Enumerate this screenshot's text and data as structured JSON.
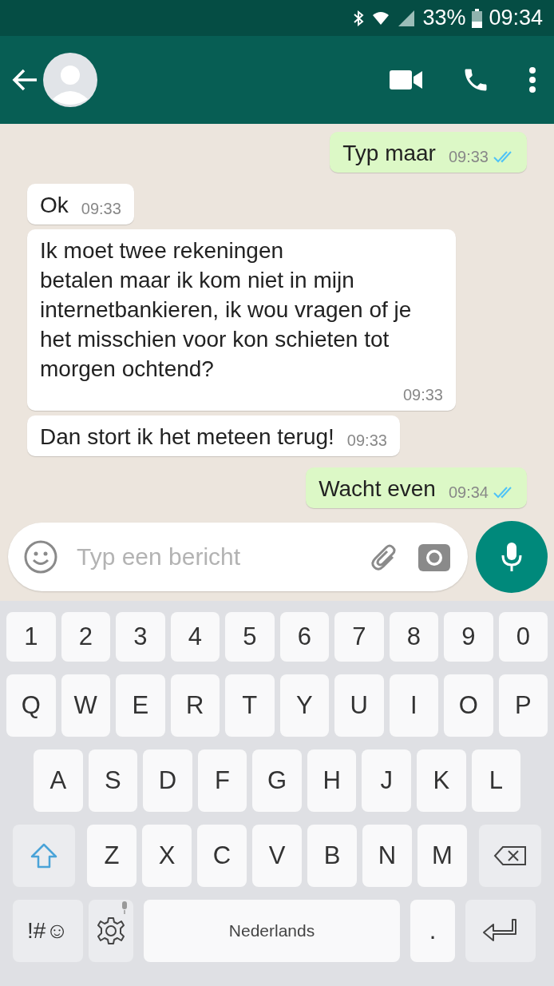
{
  "status_bar": {
    "battery": "33%",
    "time": "09:34"
  },
  "messages": [
    {
      "kind": "out",
      "text": "Typ maar",
      "time": "09:33",
      "read": true
    },
    {
      "kind": "in",
      "text": "Ok",
      "time": "09:33"
    },
    {
      "kind": "in",
      "text": "Ik moet twee rekeningen\nbetalen maar ik kom niet in mijn internetbankieren, ik wou vragen of je het misschien voor kon schieten tot morgen ochtend?",
      "time": "09:33"
    },
    {
      "kind": "in",
      "text": "Dan stort ik het meteen terug!",
      "time": "09:33"
    },
    {
      "kind": "out",
      "text": "Wacht even",
      "time": "09:34",
      "read": true
    }
  ],
  "composer": {
    "placeholder": "Typ een bericht"
  },
  "keyboard": {
    "rows": [
      {
        "keys": [
          {
            "kind": "char",
            "label": "1"
          },
          {
            "kind": "char",
            "label": "2"
          },
          {
            "kind": "char",
            "label": "3"
          },
          {
            "kind": "char",
            "label": "4"
          },
          {
            "kind": "char",
            "label": "5"
          },
          {
            "kind": "char",
            "label": "6"
          },
          {
            "kind": "char",
            "label": "7"
          },
          {
            "kind": "char",
            "label": "8"
          },
          {
            "kind": "char",
            "label": "9"
          },
          {
            "kind": "char",
            "label": "0"
          }
        ]
      },
      {
        "keys": [
          {
            "kind": "char",
            "label": "Q"
          },
          {
            "kind": "char",
            "label": "W"
          },
          {
            "kind": "char",
            "label": "E"
          },
          {
            "kind": "char",
            "label": "R"
          },
          {
            "kind": "char",
            "label": "T"
          },
          {
            "kind": "char",
            "label": "Y"
          },
          {
            "kind": "char",
            "label": "U"
          },
          {
            "kind": "char",
            "label": "I"
          },
          {
            "kind": "char",
            "label": "O"
          },
          {
            "kind": "char",
            "label": "P"
          }
        ]
      },
      {
        "keys": [
          {
            "kind": "char",
            "label": "A"
          },
          {
            "kind": "char",
            "label": "S"
          },
          {
            "kind": "char",
            "label": "D"
          },
          {
            "kind": "char",
            "label": "F"
          },
          {
            "kind": "char",
            "label": "G"
          },
          {
            "kind": "char",
            "label": "H"
          },
          {
            "kind": "char",
            "label": "J"
          },
          {
            "kind": "char",
            "label": "K"
          },
          {
            "kind": "char",
            "label": "L"
          }
        ]
      },
      {
        "keys": [
          {
            "kind": "shift"
          },
          {
            "kind": "char",
            "label": "Z"
          },
          {
            "kind": "char",
            "label": "X"
          },
          {
            "kind": "char",
            "label": "C"
          },
          {
            "kind": "char",
            "label": "V"
          },
          {
            "kind": "char",
            "label": "B"
          },
          {
            "kind": "char",
            "label": "N"
          },
          {
            "kind": "char",
            "label": "M"
          },
          {
            "kind": "backspace"
          }
        ]
      },
      {
        "keys": [
          {
            "kind": "symbols",
            "label": "!#☺"
          },
          {
            "kind": "settings"
          },
          {
            "kind": "space",
            "label": "Nederlands"
          },
          {
            "kind": "period",
            "label": "."
          },
          {
            "kind": "enter"
          }
        ]
      }
    ]
  }
}
